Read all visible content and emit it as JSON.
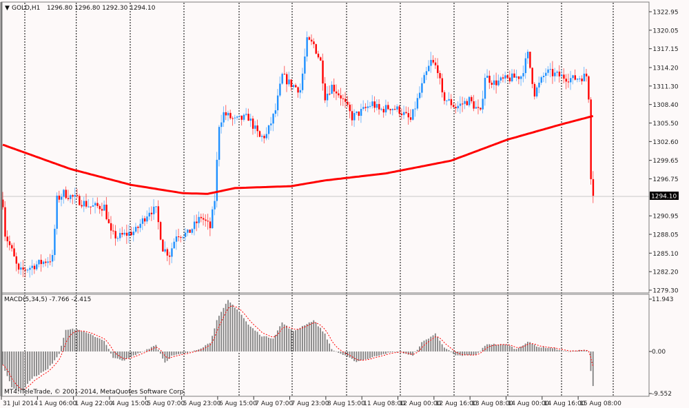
{
  "header": {
    "collapse_icon": "triangle-down-icon",
    "symbol": "GOLD,H1",
    "ohlc": "1296.80 1296.80 1292.30 1294.10"
  },
  "macd_header": "MACD(5,34,5) -7.766 -2.415",
  "copyright": "MT4: TeleTrade, © 2001-2014, MetaQuotes Software Corp.",
  "colors": {
    "background": "#fdf9f9",
    "bull": "#1e90ff",
    "bear": "#ff0000",
    "ma": "#ff0000",
    "grid": "#000000",
    "histogram": "#808080",
    "signal": "#ff0000"
  },
  "chart_data": {
    "type": "candlestick",
    "title": "GOLD,H1",
    "price_axis": {
      "ylim": [
        1279.3,
        1322.95
      ],
      "tick_labels": [
        "1322.95",
        "1320.05",
        "1317.15",
        "1314.20",
        "1311.30",
        "1308.40",
        "1305.50",
        "1302.60",
        "1299.65",
        "1296.75",
        "1294.10",
        "1290.95",
        "1288.05",
        "1285.10",
        "1282.20",
        "1279.30"
      ],
      "current_price": "1294.10"
    },
    "time_axis": {
      "tick_labels": [
        "31 Jul 2014",
        "1 Aug 06:00",
        "1 Aug 22:00",
        "4 Aug 15:00",
        "5 Aug 07:00",
        "5 Aug 23:00",
        "6 Aug 15:00",
        "7 Aug 07:00",
        "7 Aug 23:00",
        "8 Aug 15:00",
        "11 Aug 08:00",
        "12 Aug 00:00",
        "12 Aug 16:00",
        "13 Aug 08:00",
        "14 Aug 00:00",
        "14 Aug 16:00",
        "15 Aug 08:00"
      ],
      "bars_between_labels": 16,
      "bar_count": 263
    },
    "close_keypoints": [
      [
        0,
        1293.0
      ],
      [
        1,
        1288.1
      ],
      [
        4,
        1285.4
      ],
      [
        7,
        1282.1
      ],
      [
        14,
        1283.2
      ],
      [
        22,
        1284.3
      ],
      [
        24,
        1293.5
      ],
      [
        27,
        1294.5
      ],
      [
        33,
        1293.5
      ],
      [
        39,
        1292.4
      ],
      [
        45,
        1292.4
      ],
      [
        48,
        1288.1
      ],
      [
        51,
        1287.6
      ],
      [
        59,
        1288.6
      ],
      [
        65,
        1291.8
      ],
      [
        68,
        1291.8
      ],
      [
        71,
        1285.9
      ],
      [
        74,
        1284.9
      ],
      [
        77,
        1288.1
      ],
      [
        82,
        1288.1
      ],
      [
        88,
        1290.8
      ],
      [
        92,
        1289.1
      ],
      [
        94,
        1293.5
      ],
      [
        96,
        1305.3
      ],
      [
        98,
        1307.0
      ],
      [
        103,
        1305.9
      ],
      [
        109,
        1306.4
      ],
      [
        114,
        1303.2
      ],
      [
        117,
        1303.6
      ],
      [
        121,
        1307.5
      ],
      [
        124,
        1312.9
      ],
      [
        127,
        1311.8
      ],
      [
        132,
        1310.7
      ],
      [
        135,
        1318.3
      ],
      [
        138,
        1317.8
      ],
      [
        141,
        1315.1
      ],
      [
        143,
        1309.7
      ],
      [
        146,
        1311.3
      ],
      [
        150,
        1309.7
      ],
      [
        155,
        1306.4
      ],
      [
        160,
        1307.5
      ],
      [
        164,
        1308.6
      ],
      [
        167,
        1307.5
      ],
      [
        172,
        1308.0
      ],
      [
        176,
        1307.5
      ],
      [
        181,
        1305.9
      ],
      [
        184,
        1309.1
      ],
      [
        187,
        1312.4
      ],
      [
        190,
        1315.1
      ],
      [
        193,
        1314.0
      ],
      [
        195,
        1309.7
      ],
      [
        201,
        1308.0
      ],
      [
        207,
        1309.1
      ],
      [
        212,
        1307.0
      ],
      [
        214,
        1312.9
      ],
      [
        218,
        1311.8
      ],
      [
        224,
        1312.4
      ],
      [
        230,
        1312.9
      ],
      [
        233,
        1316.2
      ],
      [
        236,
        1310.2
      ],
      [
        241,
        1313.5
      ],
      [
        247,
        1312.9
      ],
      [
        253,
        1312.4
      ],
      [
        259,
        1312.9
      ],
      [
        260,
        1309.7
      ],
      [
        261,
        1296.7
      ],
      [
        262,
        1294.1
      ]
    ],
    "ma_keypoints": [
      [
        0,
        1302.1
      ],
      [
        30,
        1298.3
      ],
      [
        57,
        1295.8
      ],
      [
        80,
        1294.5
      ],
      [
        91,
        1294.4
      ],
      [
        103,
        1295.3
      ],
      [
        128,
        1295.6
      ],
      [
        143,
        1296.5
      ],
      [
        170,
        1297.6
      ],
      [
        199,
        1299.6
      ],
      [
        224,
        1302.9
      ],
      [
        248,
        1305.3
      ],
      [
        262,
        1306.6
      ]
    ],
    "macd": {
      "name": "MACD(5,34,5)",
      "main_value": -7.766,
      "signal_value": -2.415,
      "ylim": [
        -9.552,
        11.943
      ],
      "tick_labels": [
        "11.943",
        "0.00",
        "-9.552"
      ],
      "histogram_keypoints": [
        [
          0,
          -3
        ],
        [
          4,
          -8
        ],
        [
          8,
          -9.3
        ],
        [
          13,
          -6
        ],
        [
          20,
          -4
        ],
        [
          25,
          -0.5
        ],
        [
          28,
          5
        ],
        [
          33,
          5
        ],
        [
          39,
          3.8
        ],
        [
          45,
          2.5
        ],
        [
          49,
          -1.5
        ],
        [
          54,
          -2
        ],
        [
          60,
          -0.5
        ],
        [
          68,
          1.5
        ],
        [
          72,
          -2.5
        ],
        [
          75,
          -1
        ],
        [
          82,
          -0.3
        ],
        [
          88,
          0.8
        ],
        [
          92,
          2
        ],
        [
          95,
          7
        ],
        [
          100,
          11.5
        ],
        [
          105,
          9
        ],
        [
          109,
          6
        ],
        [
          115,
          3.5
        ],
        [
          120,
          3
        ],
        [
          124,
          6.5
        ],
        [
          129,
          4.5
        ],
        [
          134,
          6
        ],
        [
          138,
          7
        ],
        [
          143,
          4
        ],
        [
          146,
          0.5
        ],
        [
          152,
          -1
        ],
        [
          157,
          -2.3
        ],
        [
          163,
          -1.5
        ],
        [
          169,
          -0.5
        ],
        [
          176,
          0
        ],
        [
          182,
          -1
        ],
        [
          186,
          2
        ],
        [
          192,
          4
        ],
        [
          196,
          1
        ],
        [
          201,
          -1
        ],
        [
          210,
          -0.8
        ],
        [
          215,
          1.7
        ],
        [
          224,
          1.5
        ],
        [
          228,
          0.5
        ],
        [
          233,
          2.2
        ],
        [
          238,
          1
        ],
        [
          244,
          0.8
        ],
        [
          250,
          0
        ],
        [
          258,
          0.3
        ],
        [
          260,
          0
        ],
        [
          261,
          -4.5
        ],
        [
          262,
          -7.766
        ]
      ]
    }
  }
}
